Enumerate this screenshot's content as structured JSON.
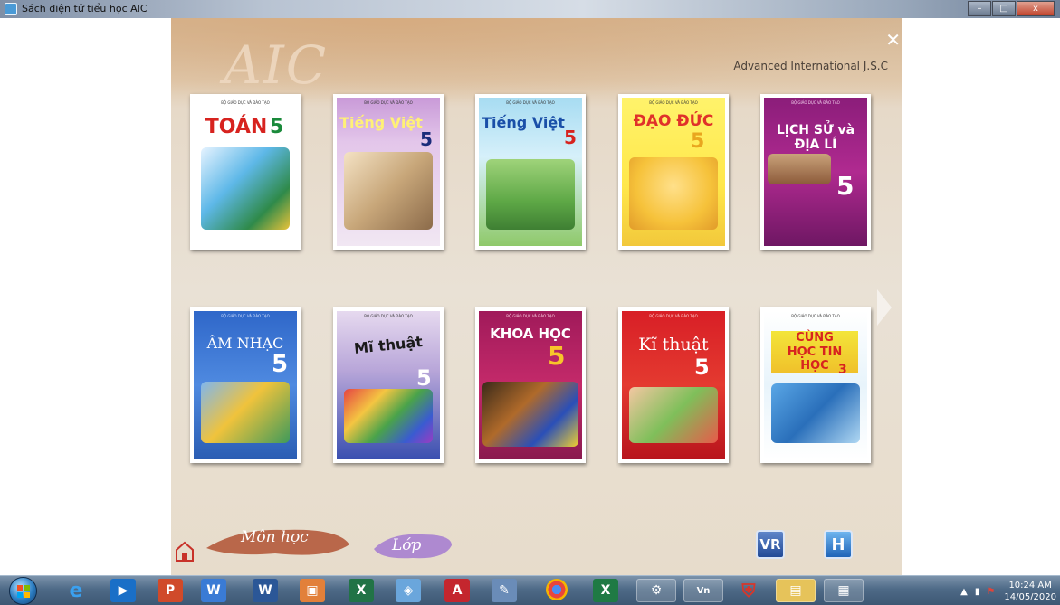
{
  "window": {
    "title": "Sách điện tử tiểu học AIC",
    "minimize_glyph": "–",
    "maximize_glyph": "□",
    "close_glyph": "x"
  },
  "app": {
    "logo": "AIC",
    "company": "Advanced International J.S.C",
    "close_glyph": "✕",
    "books": [
      {
        "publisher": "BỘ GIÁO DỤC VÀ ĐÀO TẠO",
        "title": "TOÁN",
        "grade": "5"
      },
      {
        "publisher": "BỘ GIÁO DỤC VÀ ĐÀO TẠO",
        "title": "Tiếng Việt",
        "grade": "5"
      },
      {
        "publisher": "BỘ GIÁO DỤC VÀ ĐÀO TẠO",
        "title": "Tiếng Việt",
        "grade": "5"
      },
      {
        "publisher": "BỘ GIÁO DỤC VÀ ĐÀO TẠO",
        "title": "ĐẠO ĐỨC",
        "grade": "5"
      },
      {
        "publisher": "BỘ GIÁO DỤC VÀ ĐÀO TẠO",
        "title": "LỊCH SỬ và ĐỊA LÍ",
        "grade": "5"
      },
      {
        "publisher": "BỘ GIÁO DỤC VÀ ĐÀO TẠO",
        "title": "ÂM NHẠC",
        "grade": "5"
      },
      {
        "publisher": "BỘ GIÁO DỤC VÀ ĐÀO TẠO",
        "title": "Mĩ thuật",
        "grade": "5"
      },
      {
        "publisher": "BỘ GIÁO DỤC VÀ ĐÀO TẠO",
        "title": "KHOA HỌC",
        "grade": "5"
      },
      {
        "publisher": "BỘ GIÁO DỤC VÀ ĐÀO TẠO",
        "title": "Kĩ thuật",
        "grade": "5"
      },
      {
        "publisher": "BỘ GIÁO DỤC VÀ ĐÀO TẠO",
        "title": "CÙNG HỌC TIN HỌC",
        "grade": "3"
      }
    ],
    "nav": {
      "subjects": "Môn học",
      "grade": "Lớp",
      "vr": "VR",
      "help": "H"
    }
  },
  "taskbar": {
    "time": "10:24 AM",
    "date": "14/05/2020"
  },
  "colors": {
    "accent_purple": "#a77fd0",
    "accent_rust": "#b45a3c"
  }
}
